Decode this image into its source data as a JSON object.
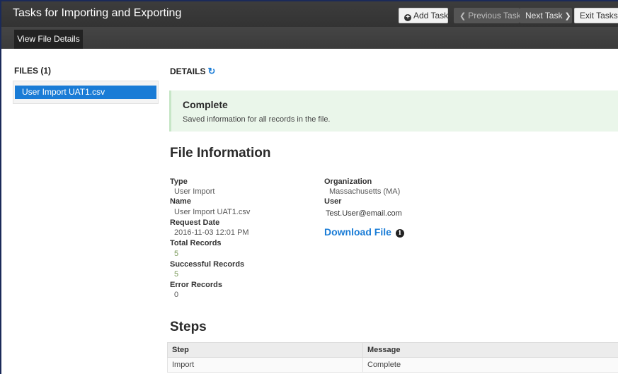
{
  "app": {
    "title": "Tasks for Importing and Exporting"
  },
  "toolbar": {
    "add_task": "Add Task",
    "previous_task": "Previous Task",
    "next_task": "Next Task",
    "exit_tasks": "Exit Tasks"
  },
  "subnav": {
    "tab_label": "View File Details"
  },
  "files": {
    "heading": "FILES (1)",
    "items": [
      {
        "label": "User Import UAT1.csv",
        "selected": true
      }
    ]
  },
  "details": {
    "heading": "DETAILS",
    "status": {
      "title": "Complete",
      "message": "Saved information for all records in the file."
    },
    "file_info": {
      "heading": "File Information",
      "type_label": "Type",
      "type_value": "User Import",
      "name_label": "Name",
      "name_value": "User Import UAT1.csv",
      "request_date_label": "Request Date",
      "request_date_value": "2016-11-03 12:01 PM",
      "total_records_label": "Total Records",
      "total_records_value": "5",
      "successful_records_label": "Successful Records",
      "successful_records_value": "5",
      "error_records_label": "Error Records",
      "error_records_value": "0",
      "organization_label": "Organization",
      "organization_value": "Massachusetts (MA)",
      "user_label": "User",
      "user_value": "Test.User@email.com",
      "download_label": "Download File"
    },
    "steps": {
      "heading": "Steps",
      "columns": [
        "Step",
        "Message"
      ],
      "rows": [
        [
          "Import",
          "Complete"
        ]
      ]
    }
  },
  "colors": {
    "accent": "#1a7cd6",
    "header_bg": "#333333",
    "success_bg": "#eaf6ea"
  },
  "icons": {
    "add": "plus-circle-icon",
    "prev": "chevron-left-icon",
    "next": "chevron-right-icon",
    "exit": "chevron-right-icon",
    "refresh": "refresh-icon",
    "info": "info-circle-icon"
  }
}
